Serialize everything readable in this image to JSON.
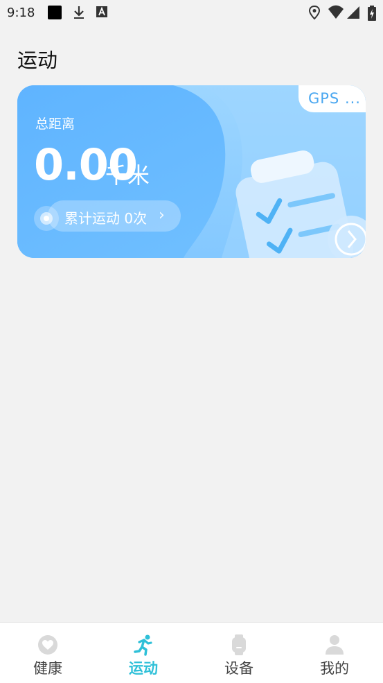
{
  "status_bar": {
    "time": "9:18"
  },
  "header": {
    "title": "运动"
  },
  "card": {
    "gps_label": "GPS ...",
    "distance_label": "总距离",
    "distance_value": "0.00",
    "distance_unit": "千米",
    "count_text": "累计运动 0次",
    "colors": {
      "card_bg": "#66b8ff",
      "card_light": "#8fd0ff"
    }
  },
  "tabbar": {
    "active_color": "#2fc0d8",
    "tabs": [
      {
        "label": "健康",
        "icon": "heart-icon",
        "active": false
      },
      {
        "label": "运动",
        "icon": "running-icon",
        "active": true
      },
      {
        "label": "设备",
        "icon": "watch-icon",
        "active": false
      },
      {
        "label": "我的",
        "icon": "person-icon",
        "active": false
      }
    ]
  }
}
